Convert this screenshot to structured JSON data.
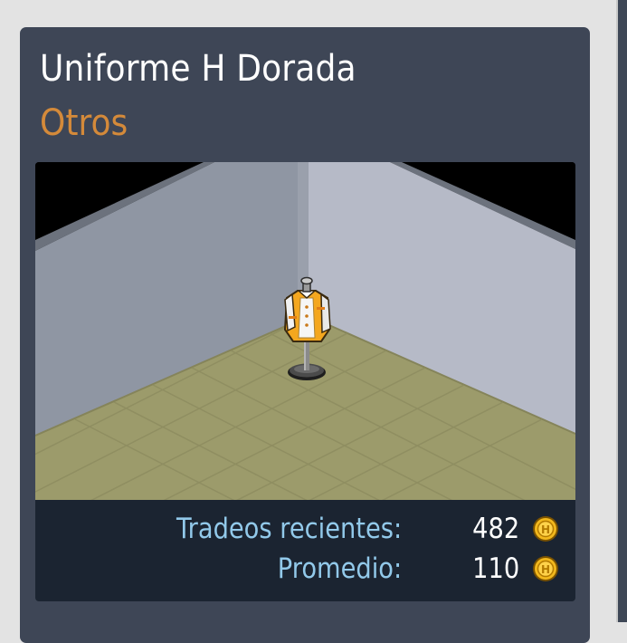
{
  "item": {
    "name": "Uniforme H Dorada",
    "category": "Otros"
  },
  "stats": {
    "recent_trades_label": "Tradeos recientes:",
    "recent_trades_value": "482",
    "average_label": "Promedio:",
    "average_value": "110",
    "currency_icon": "credit-coin-icon"
  },
  "preview": {
    "furniture_icon": "mannequin-uniform-icon",
    "colors": {
      "wall_left": "#8f96a3",
      "wall_right": "#b6bac7",
      "floor": "#9c9b6b",
      "background": "#000000",
      "panel": "#3e4656",
      "stats_bg": "#1b2431",
      "accent_orange": "#d48a3a",
      "label_blue": "#92c9ea"
    }
  }
}
